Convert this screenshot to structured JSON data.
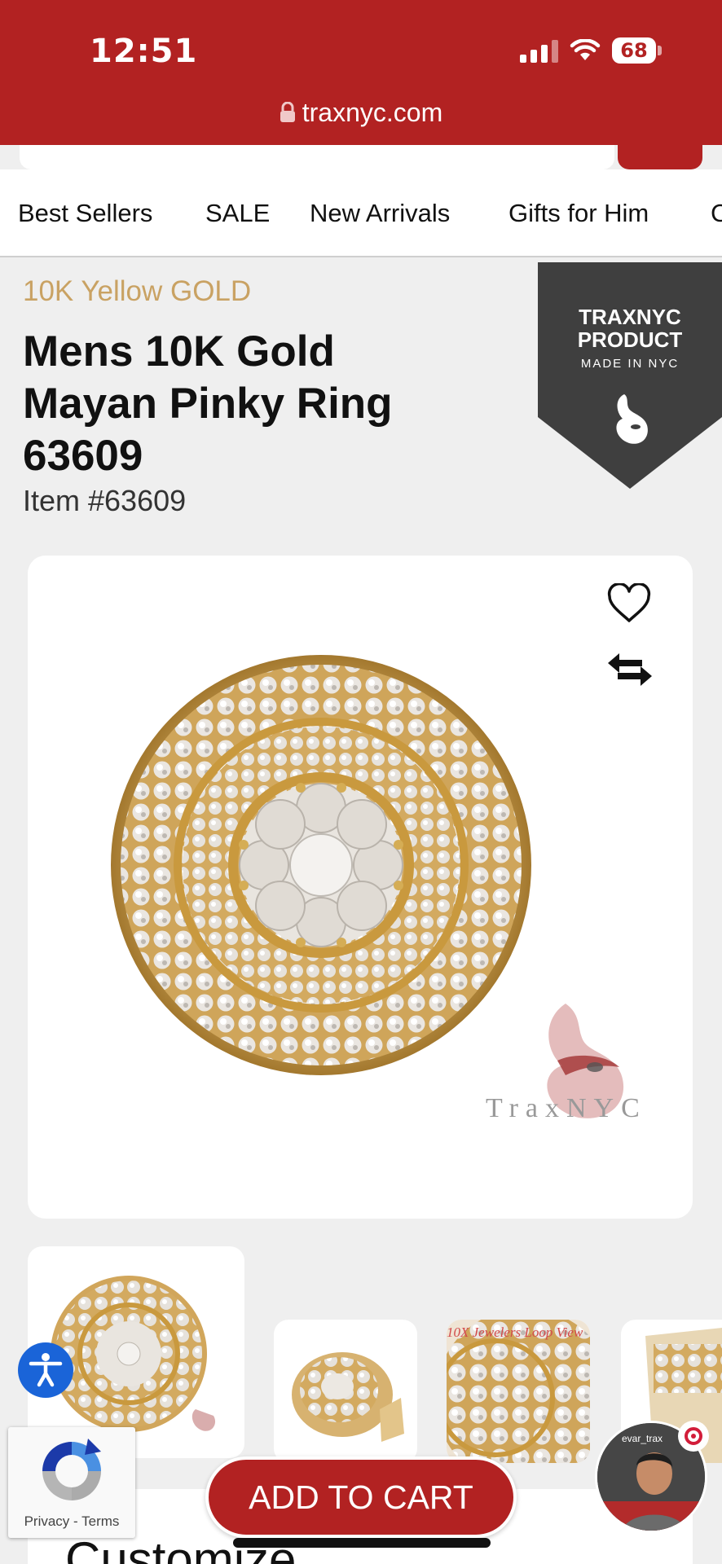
{
  "status_bar": {
    "time": "12:51",
    "battery": "68",
    "icons": [
      "signal-icon",
      "wifi-icon",
      "battery-icon"
    ]
  },
  "browser": {
    "url": "traxnyc.com"
  },
  "nav": {
    "items": [
      "Best Sellers",
      "SALE",
      "New Arrivals",
      "Gifts for Him",
      "C"
    ]
  },
  "product": {
    "metal": "10K Yellow GOLD",
    "title": "Mens 10K Gold Mayan Pinky Ring 63609",
    "item_number": "Item #63609"
  },
  "badge": {
    "line1": "TRAXNYC PRODUCT",
    "line2": "MADE IN NYC"
  },
  "image": {
    "watermark": "TraxNYC"
  },
  "thumbnails": {
    "thumb3_caption": "10X Jewelers Loop View"
  },
  "recaptcha": {
    "privacy": "Privacy",
    "separator": "-",
    "terms": "Terms"
  },
  "actions": {
    "add_to_cart": "ADD TO CART"
  },
  "section": {
    "customize": "Customize"
  },
  "video": {
    "caption": "evar_trax"
  },
  "colors": {
    "brand_red": "#b22222",
    "gold_text": "#c9a263",
    "badge_dark": "#3f3f3f",
    "accessibility_blue": "#1a64d8"
  }
}
